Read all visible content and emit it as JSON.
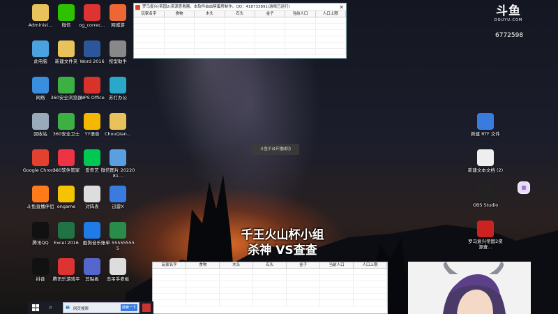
{
  "stream": {
    "logo": "斗鱼",
    "logo_sub": "DOUYU.COM",
    "room_id": "6772598",
    "caption_line1": "千王火山杯小组",
    "caption_line2": "杀神  VS查查",
    "toast": "斗鱼平台开播成功"
  },
  "desktop_left": [
    {
      "label": "Administ...",
      "icon": "user-folder-icon",
      "color": "#e8c25a"
    },
    {
      "label": "微信",
      "icon": "wechat-icon",
      "color": "#2dc100"
    },
    {
      "label": "og_correc...",
      "icon": "record-icon",
      "color": "#d33"
    },
    {
      "label": "网城游",
      "icon": "game-icon",
      "color": "#e63"
    },
    {
      "label": "此电脑",
      "icon": "computer-icon",
      "color": "#4aa3e0"
    },
    {
      "label": "新建文件夹",
      "icon": "folder-icon",
      "color": "#e8c25a"
    },
    {
      "label": "Word 2016",
      "icon": "word-icon",
      "color": "#2b579a"
    },
    {
      "label": "按型助手",
      "icon": "tool-icon",
      "color": "#888"
    },
    {
      "label": "网络",
      "icon": "network-icon",
      "color": "#3a8ee0"
    },
    {
      "label": "360安全浏览器",
      "icon": "360-browser-icon",
      "color": "#3cb043"
    },
    {
      "label": "WPS Office",
      "icon": "wps-icon",
      "color": "#d9322b"
    },
    {
      "label": "苏打办公",
      "icon": "office-icon",
      "color": "#2aa8c9"
    },
    {
      "label": "回收站",
      "icon": "recycle-bin-icon",
      "color": "#9ab"
    },
    {
      "label": "360安全卫士",
      "icon": "360-guard-icon",
      "color": "#3cb043"
    },
    {
      "label": "YY语音",
      "icon": "yy-icon",
      "color": "#f5b800"
    },
    {
      "label": "ChouQian...",
      "icon": "folder-icon",
      "color": "#e8c25a"
    },
    {
      "label": "Google Chrome",
      "icon": "chrome-icon",
      "color": "#e3412f"
    },
    {
      "label": "360软件管家",
      "icon": "360-software-icon",
      "color": "#e34"
    },
    {
      "label": "爱奇艺",
      "icon": "iqiyi-icon",
      "color": "#00c853"
    },
    {
      "label": "微信图片 2022081...",
      "icon": "image-file-icon",
      "color": "#5aa0e0"
    },
    {
      "label": "斗鱼直播伴侣",
      "icon": "douyu-companion-icon",
      "color": "#ff7a1a"
    },
    {
      "label": "ongame",
      "icon": "ongame-icon",
      "color": "#f5c400"
    },
    {
      "label": "对阵表",
      "icon": "document-icon",
      "color": "#ddd"
    },
    {
      "label": "迅雷X",
      "icon": "xunlei-icon",
      "color": "#3a7be0"
    },
    {
      "label": "腾讯QQ",
      "icon": "qq-icon",
      "color": "#111"
    },
    {
      "label": "Excel 2016",
      "icon": "excel-icon",
      "color": "#217346"
    },
    {
      "label": "酷狗音乐",
      "icon": "kugou-icon",
      "color": "#1f7be8"
    },
    {
      "label": "账单 555555555",
      "icon": "spreadsheet-icon",
      "color": "#2a8c4a"
    },
    {
      "label": "抖音",
      "icon": "douyin-icon",
      "color": "#111"
    },
    {
      "label": "腾讯乐游戏平",
      "icon": "tencent-game-icon",
      "color": "#d33"
    },
    {
      "label": "剪贴板",
      "icon": "clipboard-icon",
      "color": "#5566cc"
    },
    {
      "label": "击吊手老板",
      "icon": "document-icon",
      "color": "#ddd"
    }
  ],
  "desktop_right": [
    {
      "label": "新建 RTF 文件",
      "icon": "rtf-file-icon",
      "color": "#3a7be0"
    },
    {
      "label": "新建文本文档 (2)",
      "icon": "text-file-icon",
      "color": "#eee"
    },
    {
      "label": "OBS Studio",
      "icon": "obs-icon",
      "color": "#222"
    },
    {
      "label": "罗马复兴帝国2资源查...",
      "icon": "rome-app-icon",
      "color": "#c22"
    }
  ],
  "window_top": {
    "title": "罗马复兴(帝国2)资源查看器，本软件由血禁蛋房制作。QQ：418733891(游戏已运行)",
    "columns": [
      "玩家名字",
      "食物",
      "木头",
      "石头",
      "金子",
      "当前人口",
      "人口上限"
    ]
  },
  "window_bottom": {
    "columns": [
      "玩家名字",
      "食物",
      "木头",
      "石头",
      "金子",
      "当前人口",
      "人口上限"
    ]
  },
  "taskbar": {
    "search_text": "网页搜索",
    "search_button": "搜索一下"
  }
}
